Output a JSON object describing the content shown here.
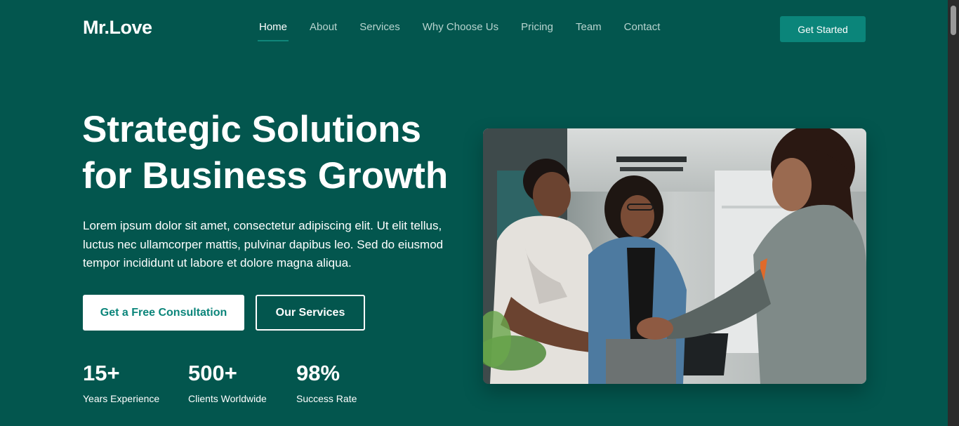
{
  "header": {
    "logo": "Mr.Love",
    "nav": [
      {
        "label": "Home",
        "active": true
      },
      {
        "label": "About",
        "active": false
      },
      {
        "label": "Services",
        "active": false
      },
      {
        "label": "Why Choose Us",
        "active": false
      },
      {
        "label": "Pricing",
        "active": false
      },
      {
        "label": "Team",
        "active": false
      },
      {
        "label": "Contact",
        "active": false
      }
    ],
    "cta_label": "Get Started"
  },
  "hero": {
    "title_line1": "Strategic Solutions",
    "title_line2": "for Business Growth",
    "description": "Lorem ipsum dolor sit amet, consectetur adipiscing elit. Ut elit tellus, luctus nec ullamcorper mattis, pulvinar dapibus leo. Sed do eiusmod tempor incididunt ut labore et dolore magna aliqua.",
    "primary_button": "Get a Free Consultation",
    "secondary_button": "Our Services",
    "stats": [
      {
        "value": "15+",
        "label": "Years Experience"
      },
      {
        "value": "500+",
        "label": "Clients Worldwide"
      },
      {
        "value": "98%",
        "label": "Success Rate"
      }
    ],
    "image_icon": "team-handshake-photo"
  },
  "colors": {
    "background": "#03564e",
    "accent": "#0b857a",
    "nav_inactive": "#b8d4cf"
  }
}
